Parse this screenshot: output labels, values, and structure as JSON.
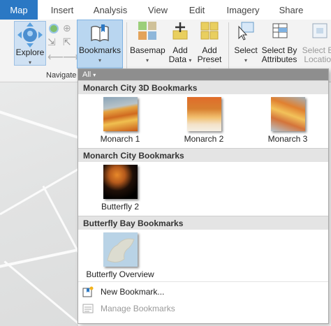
{
  "tabs": [
    "Map",
    "Insert",
    "Analysis",
    "View",
    "Edit",
    "Imagery",
    "Share"
  ],
  "ribbon": {
    "explore_label": "Explore",
    "bookmarks_label": "Bookmarks",
    "basemap_label": "Basemap",
    "add_data_label": "Add",
    "add_data_label2": "Data",
    "add_preset_label": "Add",
    "add_preset_label2": "Preset",
    "select_label": "Select",
    "select_by_attr_label": "Select By",
    "select_by_attr_label2": "Attributes",
    "select_by_loc_label": "Select By",
    "select_by_loc_label2": "Location",
    "navigate_group_label": "Navigate"
  },
  "gallery": {
    "filter_label": "All",
    "sections": [
      {
        "title": "Monarch City 3D Bookmarks",
        "items": [
          "Monarch 1",
          "Monarch 2",
          "Monarch 3"
        ]
      },
      {
        "title": "Monarch City Bookmarks",
        "items": [
          "Butterfly 2"
        ]
      },
      {
        "title": "Butterfly Bay Bookmarks",
        "items": [
          "Butterfly Overview"
        ]
      }
    ],
    "new_bookmark": "New Bookmark...",
    "manage_bookmarks": "Manage Bookmarks"
  },
  "colors": {
    "accent": "#2b78c4",
    "ribbon_bg": "#f3f3f3",
    "section_bg": "#e4e4e4",
    "filter_bg": "#8e8e8e",
    "bookmarks_btn_bg": "#b9d6f0"
  }
}
